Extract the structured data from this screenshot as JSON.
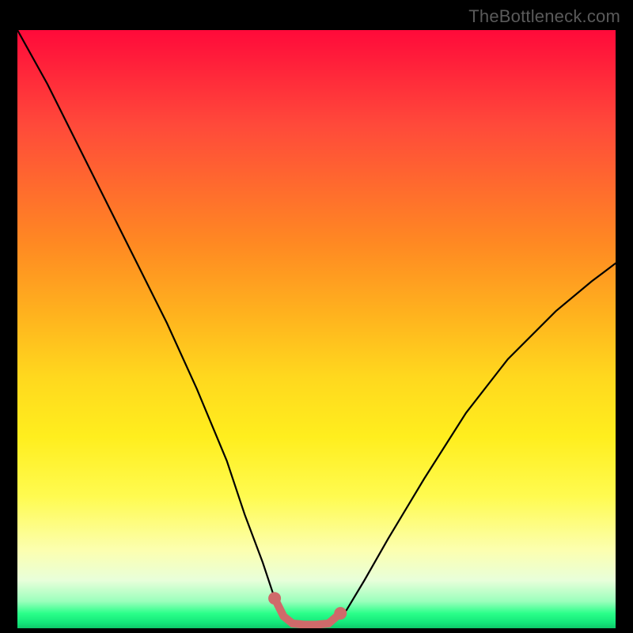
{
  "watermark": "TheBottleneck.com",
  "gradient_colors": {
    "top": "#ff0a3a",
    "mid_upper": "#ff8a22",
    "mid": "#ffee1e",
    "mid_lower": "#fcffb0",
    "bottom": "#14e87a"
  },
  "chart_data": {
    "type": "line",
    "title": "",
    "xlabel": "",
    "ylabel": "",
    "xlim": [
      0,
      100
    ],
    "ylim": [
      0,
      100
    ],
    "grid": false,
    "legend": false,
    "series": [
      {
        "name": "main-curve",
        "color": "#000000",
        "x": [
          0,
          5,
          10,
          15,
          20,
          25,
          30,
          35,
          38,
          41,
          43,
          44.5,
          46,
          48,
          50,
          52,
          55,
          58,
          62,
          68,
          75,
          82,
          90,
          96,
          100
        ],
        "y": [
          100,
          91,
          81,
          71,
          61,
          51,
          40,
          28,
          19,
          11,
          5,
          2,
          0.8,
          0.6,
          0.6,
          0.8,
          3,
          8,
          15,
          25,
          36,
          45,
          53,
          58,
          61
        ]
      },
      {
        "name": "highlight-segment",
        "color": "#cf6a6a",
        "x": [
          43,
          44.5,
          46,
          48,
          50,
          52,
          54
        ],
        "y": [
          5,
          2,
          0.8,
          0.6,
          0.6,
          0.8,
          2.5
        ]
      }
    ],
    "markers": [
      {
        "name": "left-dot",
        "x": 43,
        "y": 5,
        "color": "#cf6a6a"
      },
      {
        "name": "right-dot",
        "x": 54,
        "y": 2.5,
        "color": "#cf6a6a"
      }
    ]
  }
}
